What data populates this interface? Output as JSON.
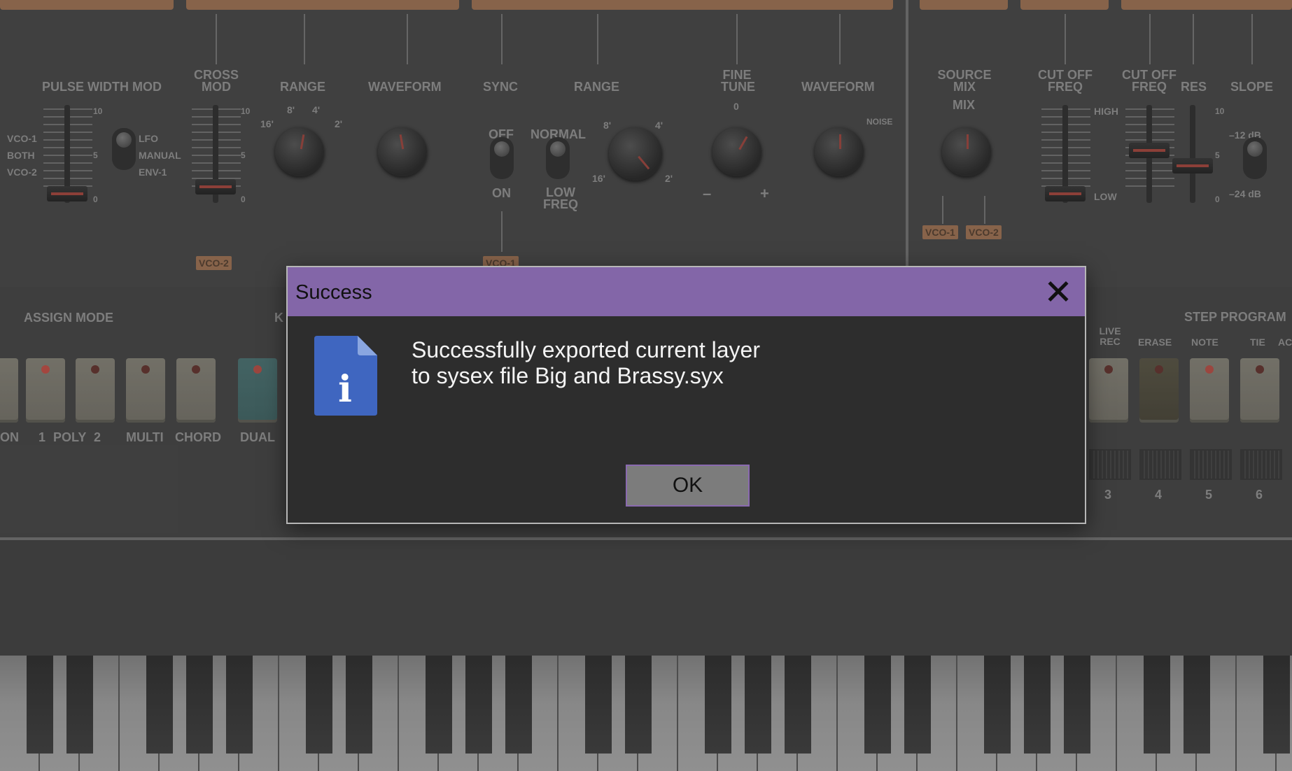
{
  "vco1": {
    "pulse_width_mod": "PULSE WIDTH MOD",
    "pwm_sources": [
      "VCO-1",
      "BOTH",
      "VCO-2"
    ],
    "pwm_modes": [
      "LFO",
      "MANUAL",
      "ENV-1"
    ],
    "scale": [
      "10",
      "5",
      "0"
    ],
    "cross_mod": "CROSS MOD",
    "range": "RANGE",
    "range_marks": [
      "16'",
      "8'",
      "4'",
      "2'"
    ],
    "waveform": "WAVEFORM",
    "vco2_tag": "VCO-2"
  },
  "vco2": {
    "sync": "SYNC",
    "sync_off": "OFF",
    "sync_on": "ON",
    "range": "RANGE",
    "normal": "NORMAL",
    "low_freq": "LOW FREQ",
    "range_marks": [
      "8'",
      "4'",
      "16'",
      "2'"
    ],
    "fine_tune": "FINE TUNE",
    "fine_zero": "0",
    "minus": "–",
    "plus": "+",
    "waveform": "WAVEFORM",
    "noise": "NOISE",
    "vco1_tag": "VCO-1"
  },
  "filter": {
    "source_mix": "SOURCE MIX",
    "mix": "MIX",
    "vco1_tag": "VCO-1",
    "vco2_tag": "VCO-2",
    "hpf_cutoff": "CUT OFF FREQ",
    "high": "HIGH",
    "low": "LOW",
    "lpf_cutoff": "CUT OFF FREQ",
    "res": "RES",
    "scale": [
      "10",
      "5",
      "0"
    ],
    "slope": "SLOPE",
    "slope_12": "–12 dB",
    "slope_24": "–24 dB"
  },
  "assign": {
    "title": "ASSIGN MODE",
    "labels": [
      "ON",
      "1",
      "POLY",
      "2",
      "MULTI",
      "CHORD"
    ],
    "key_section": "K",
    "dual": "DUAL"
  },
  "step": {
    "live_rec": "LIVE REC",
    "title": "STEP PROGRAM",
    "erase": "ERASE",
    "note": "NOTE",
    "tie": "TIE",
    "ac": "AC",
    "numbers": [
      "3",
      "4",
      "5",
      "6"
    ]
  },
  "dialog": {
    "title": "Success",
    "icon": "info-document-icon",
    "icon_letter": "i",
    "message_line1": "Successfully exported current layer",
    "message_line2": "to sysex file Big and Brassy.syx",
    "ok_label": "OK"
  },
  "colors": {
    "title_bar": "#8366a8",
    "dialog_bg": "#2d2d2d",
    "icon_blue": "#3f66c0",
    "accent_orange": "#9a6a49"
  }
}
